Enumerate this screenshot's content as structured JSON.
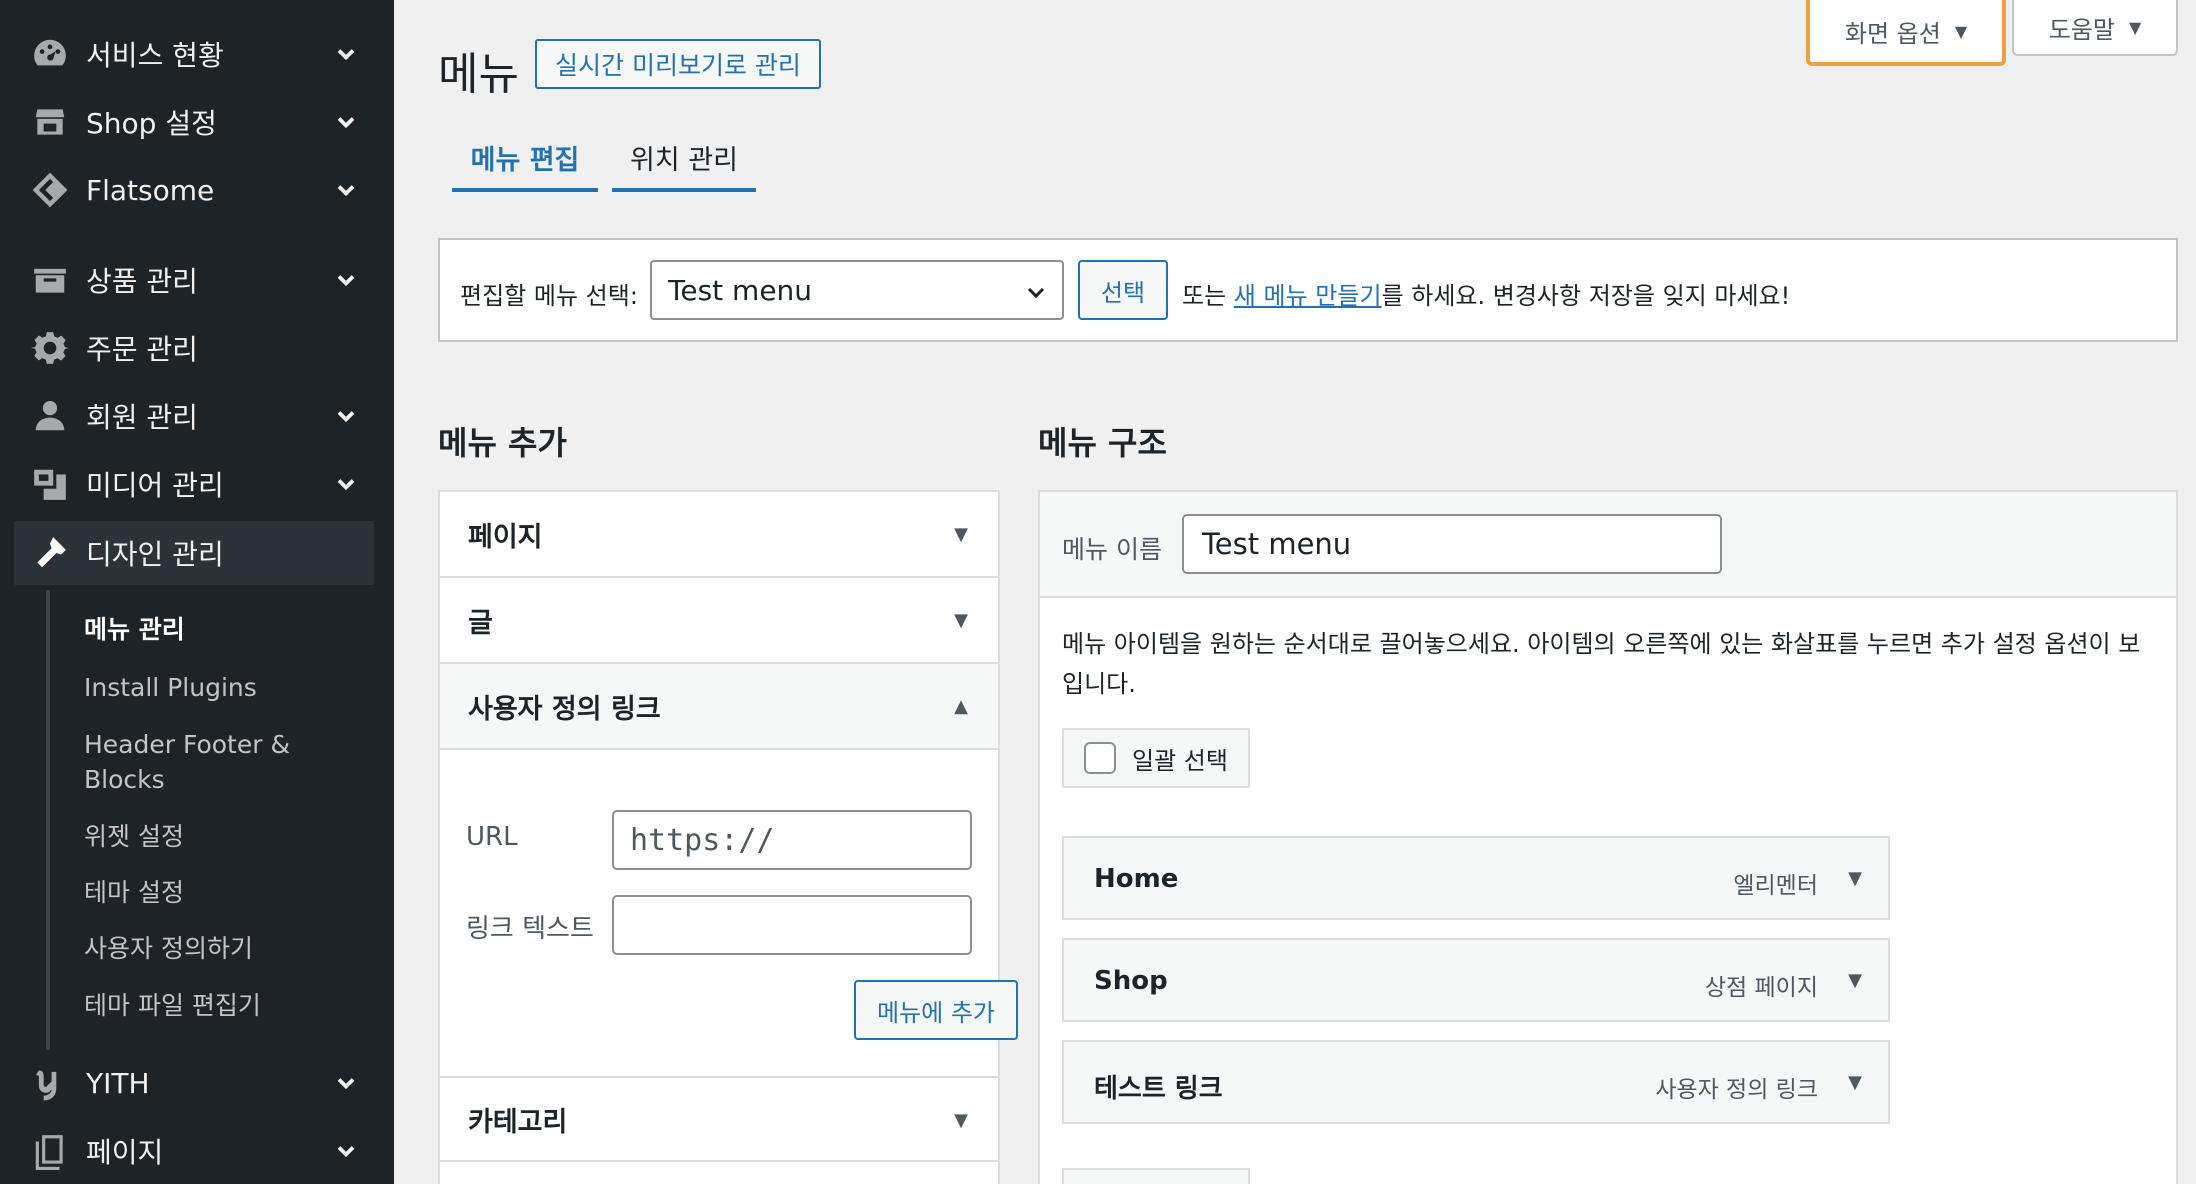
{
  "sidebar": {
    "items": [
      {
        "label": "서비스 현황",
        "icon": "dashboard-icon"
      },
      {
        "label": "Shop 설정",
        "icon": "shop-icon"
      },
      {
        "label": "Flatsome",
        "icon": "flatsome-icon"
      },
      {
        "label": "상품 관리",
        "icon": "products-icon"
      },
      {
        "label": "주문 관리",
        "icon": "gear-icon"
      },
      {
        "label": "회원 관리",
        "icon": "user-icon"
      },
      {
        "label": "미디어 관리",
        "icon": "media-icon"
      },
      {
        "label": "디자인 관리",
        "icon": "appearance-icon"
      },
      {
        "label": "YITH",
        "icon": "yith-icon"
      },
      {
        "label": "페이지",
        "icon": "pages-icon"
      }
    ],
    "submenu": [
      "메뉴 관리",
      "Install Plugins",
      "Header Footer &",
      "Blocks",
      "위젯 설정",
      "테마 설정",
      "사용자 정의하기",
      "테마 파일 편집기"
    ]
  },
  "header": {
    "title": "메뉴",
    "preview_button": "실시간 미리보기로 관리",
    "screen_options": "화면 옵션",
    "help": "도움말"
  },
  "tabs": [
    {
      "label": "메뉴 편집",
      "active": true
    },
    {
      "label": "위치 관리",
      "active": false
    }
  ],
  "manage": {
    "label": "편집할 메뉴 선택:",
    "selected_menu": "Test menu",
    "select_button": "선택",
    "text_before": "또는 ",
    "create_link": "새 메뉴 만들기",
    "text_after": "를 하세요. 변경사항 저장을 잊지 마세요!"
  },
  "add_menu": {
    "title": "메뉴 추가",
    "panels": [
      "페이지",
      "글",
      "사용자 정의 링크",
      "카테고리"
    ],
    "url_label": "URL",
    "url_placeholder": "https://",
    "link_text_label": "링크 텍스트",
    "link_text_value": "",
    "add_button": "메뉴에 추가"
  },
  "structure": {
    "title": "메뉴 구조",
    "name_label": "메뉴 이름",
    "name_value": "Test menu",
    "instructions": "메뉴 아이템을 원하는 순서대로 끌어놓으세요. 아이템의 오른쪽에 있는 화살표를 누르면 추가 설정 옵션이 보입니다.",
    "bulk_select": "일괄 선택",
    "items": [
      {
        "title": "Home",
        "type": "엘리멘터"
      },
      {
        "title": "Shop",
        "type": "상점 페이지"
      },
      {
        "title": "테스트 링크",
        "type": "사용자 정의 링크"
      }
    ]
  },
  "colors": {
    "sidebar_bg": "#1d2327",
    "accent": "#2271b1",
    "highlight_border": "#f0a040"
  }
}
